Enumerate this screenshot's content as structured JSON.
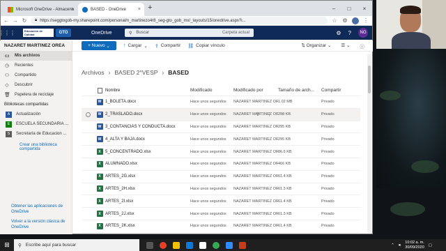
{
  "browser": {
    "tabs": [
      {
        "label": "Microsoft OneDrive - Almacena",
        "close": "×"
      },
      {
        "label": "BASED - OneDrive",
        "close": "×"
      }
    ],
    "new_tab": "+",
    "window_controls": [
      "–",
      "□",
      "×"
    ],
    "url": "https://seggtogob-my.sharepoint.com/personal/n_martinezo4r8_seg-gto_gob_mx/_layouts/15/onedrive.aspx?i..."
  },
  "header": {
    "logo_text": "Educación de Calidad",
    "logo_badge": "GTO",
    "app_name": "OneDrive",
    "search_placeholder": "Buscar",
    "search_scope": "Carpeta actual",
    "user_initials": "NO"
  },
  "sidebar": {
    "user_name": "NAZARET MARTINEZ OREA",
    "items": [
      {
        "label": "Mis archivos",
        "icon": "folder-icon",
        "active": true
      },
      {
        "label": "Recientes",
        "icon": "clock-icon"
      },
      {
        "label": "Compartido",
        "icon": "people-icon"
      },
      {
        "label": "Descubrir",
        "icon": "discover-icon"
      },
      {
        "label": "Papelera de reciclaje",
        "icon": "trash-icon"
      }
    ],
    "shared_header": "Bibliotecas compartidas",
    "libraries": [
      {
        "label": "Actualización",
        "badge": "A",
        "color": "#2b579a"
      },
      {
        "label": "ESCUELA SECUNDARIA ...",
        "badge": "E",
        "color": "#107c10"
      },
      {
        "label": "Secretaría de Educacion ...",
        "badge": "S",
        "color": "#5c5c5c"
      }
    ],
    "create_library": "Crear una biblioteca compartida",
    "footer": [
      "Obtener las aplicaciones de OneDrive",
      "Volver a la versión clásica de OneDrive"
    ]
  },
  "commands": {
    "new": "Nuevo",
    "upload": "Cargar",
    "share": "Compartir",
    "copy_link": "Copiar vínculo",
    "organize": "Organizar"
  },
  "breadcrumb": [
    "Archivos",
    "BASED 2°VESP",
    "BASED"
  ],
  "columns": {
    "name": "Nombre",
    "modified": "Modificado",
    "modified_by": "Modificado por",
    "size": "Tamaño de arch...",
    "sharing": "Compartir"
  },
  "files": [
    {
      "name": "1_BOLETA.docx",
      "type": "docx",
      "modified": "Hace unos segundos",
      "by": "NAZARET MARTINEZ ORE...",
      "size": "1.02 MB",
      "sharing": "Privado"
    },
    {
      "name": "2_TRASLADO.docx",
      "type": "docx",
      "modified": "Hace unos segundos",
      "by": "NAZARET MARTINEZ ORE...",
      "size": "298 KB",
      "sharing": "Privado",
      "hover": true
    },
    {
      "name": "3_CONTANCIAS Y CONDUCTA.docx",
      "type": "docx",
      "modified": "Hace unos segundos",
      "by": "NAZARET MARTINEZ ORE...",
      "size": "295 KB",
      "sharing": "Privado"
    },
    {
      "name": "4_ALTA Y BAJA.docx",
      "type": "docx",
      "modified": "Hace unos segundos",
      "by": "NAZARET MARTINEZ ORE...",
      "size": "295 KB",
      "sharing": "Privado"
    },
    {
      "name": "5_CONCENTRADO.xlsx",
      "type": "xlsx",
      "modified": "Hace unos segundos",
      "by": "NAZARET MARTINEZ ORE...",
      "size": "86.6 KB",
      "sharing": "Privado"
    },
    {
      "name": "ALUMNADO.xlsx",
      "type": "xlsx",
      "modified": "Hace unos segundos",
      "by": "NAZARET MARTINEZ ORE...",
      "size": "466 KB",
      "sharing": "Privado"
    },
    {
      "name": "ARTES_2G.xlsx",
      "type": "xlsx",
      "modified": "Hace unos segundos",
      "by": "NAZARET MARTINEZ ORE...",
      "size": "61.4 KB",
      "sharing": "Privado"
    },
    {
      "name": "ARTES_2H.xlsx",
      "type": "xlsx",
      "modified": "Hace unos segundos",
      "by": "NAZARET MARTINEZ ORE...",
      "size": "61.3 KB",
      "sharing": "Privado"
    },
    {
      "name": "ARTES_2I.xlsx",
      "type": "xlsx",
      "modified": "Hace unos segundos",
      "by": "NAZARET MARTINEZ ORE...",
      "size": "61.4 KB",
      "sharing": "Privado"
    },
    {
      "name": "ARTES_2J.xlsx",
      "type": "xlsx",
      "modified": "Hace unos segundos",
      "by": "NAZARET MARTINEZ ORE...",
      "size": "61.3 KB",
      "sharing": "Privado"
    },
    {
      "name": "ARTES_2K.xlsx",
      "type": "xlsx",
      "modified": "Hace unos segundos",
      "by": "NAZARET MARTINEZ ORE...",
      "size": "61.4 KB",
      "sharing": "Privado"
    }
  ],
  "taskbar": {
    "search_placeholder": "Escribe aquí para buscar",
    "time": "10:02 a. m.",
    "date": "30/09/2020"
  }
}
